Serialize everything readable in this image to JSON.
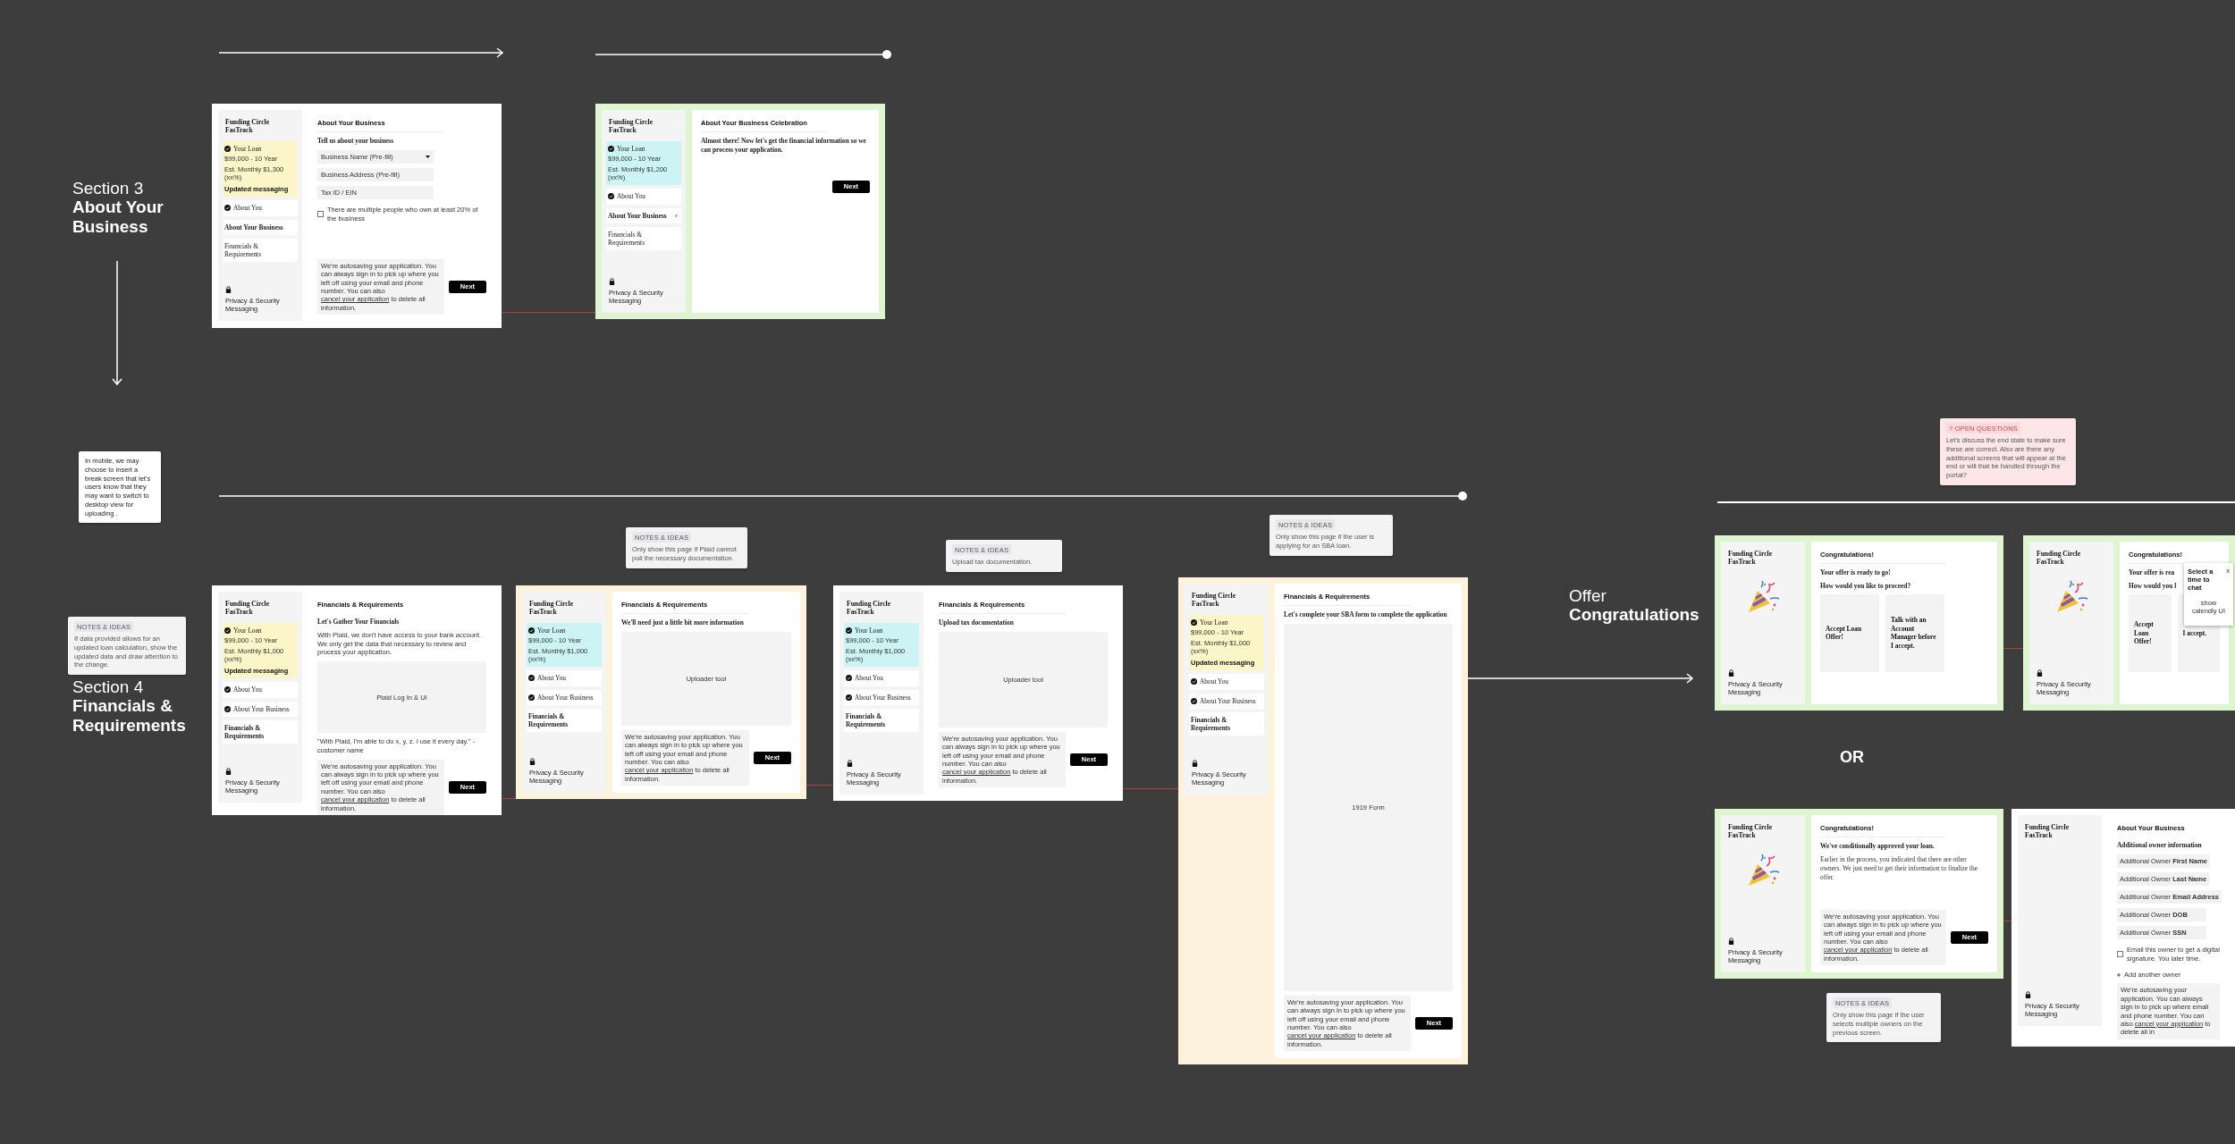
{
  "canvas": {
    "section_labels": [
      {
        "number": "Section 3",
        "title": "About Your Business"
      },
      {
        "number": "Section 4",
        "title": "Financials & Requirements"
      },
      {
        "number": "Offer",
        "title": "Congratulations"
      }
    ],
    "or_label": "OR",
    "notes": [
      {
        "kind": "plain",
        "text": "In mobile, we may choose to insert a break screen that let's users know that they may want to switch to desktop view for uploading ."
      },
      {
        "kind": "note",
        "tag": "NOTES & IDEAS",
        "text": "If data provided allows for an updated loan calculation, show the updated data and draw attention to the change."
      },
      {
        "kind": "note",
        "tag": "NOTES & IDEAS",
        "text": "Only show this page if Plaid cannot pull the necessary documentation."
      },
      {
        "kind": "note",
        "tag": "NOTES & IDEAS",
        "text": "Upload tax documentation."
      },
      {
        "kind": "note",
        "tag": "NOTES & IDEAS",
        "text": "Only show this page if the user is applying for an SBA loan."
      },
      {
        "kind": "question",
        "marker": "?",
        "tag": "OPEN QUESTIONS",
        "text": "Let's discuss the end state to make sure these are correct. Also are there any additional screens that will appear at the end or will that be handled through the portal?"
      },
      {
        "kind": "note",
        "tag": "NOTES & IDEAS",
        "text": "Only show this page if the user selects multiple owners on the previous screen."
      }
    ],
    "frames": [
      {
        "color": "#ffffff",
        "sidebar": {
          "kind": "steps",
          "brand": "Funding Circle FasTrack",
          "steps": [
            {
              "label": "Your Loan",
              "done": true,
              "current": false,
              "color": "#fbf5c8",
              "details": [
                "$99,000  - 10 Year",
                "Est. Monthly $1,300 (xx%)"
              ],
              "note": "Updated messaging"
            },
            {
              "label": "About You",
              "done": true,
              "current": false,
              "color": "#ffffff"
            },
            {
              "label": "About Your Business",
              "done": false,
              "current": true,
              "color": "#ffffff"
            },
            {
              "label": "Financials & Requirements",
              "done": false,
              "current": false,
              "color": "#ffffff"
            }
          ],
          "privacy": "Privacy & Security Messaging"
        },
        "main": {
          "breadcrumb": "About Your Business",
          "heading": "Tell us about your business",
          "blocks": [
            {
              "kind": "select",
              "placeholder": "Business Name (Pre-fill)"
            },
            {
              "kind": "field",
              "placeholder": "Business Address (Pre-fill)"
            },
            {
              "kind": "field",
              "placeholder": "Tax ID / EIN"
            },
            {
              "kind": "checkbox",
              "label": "There are multiple people who own at least 20% of the business",
              "checked": false
            }
          ],
          "autosave": {
            "before": "We're autosaving your application. You can always sign in to pick up where you left off using your email and phone number. You can also ",
            "link": "cancel your application",
            "after": " to delete all information."
          },
          "next": "Next"
        }
      },
      {
        "color": "#dff5cf",
        "sidebar": {
          "kind": "steps",
          "brand": "Funding Circle FasTrack",
          "steps": [
            {
              "label": "Your Loan",
              "done": true,
              "current": false,
              "celebrate": false,
              "color": "#cdf4f4",
              "details": [
                "$99,000  - 10 Year",
                "Est. Monthly $1,200 (xx%)"
              ]
            },
            {
              "label": "About You",
              "done": true,
              "current": false,
              "celebrate": false,
              "color": "#ffffff"
            },
            {
              "label": "About Your Business",
              "done": false,
              "current": true,
              "celebrate": true,
              "color": "#ffffff"
            },
            {
              "label": "Financials & Requirements",
              "done": false,
              "current": false,
              "celebrate": false,
              "color": "#ffffff"
            }
          ],
          "privacy": "Privacy & Security Messaging"
        },
        "main": {
          "breadcrumb": "About Your Business Celebration",
          "heading": "Almost there! Now let's get the financial information so we can process your application.",
          "blocks": [
            {
              "kind": "next",
              "label": "Next"
            }
          ]
        }
      },
      {
        "color": "#ffffff",
        "sidebar": {
          "kind": "steps",
          "brand": "Funding Circle FasTrack",
          "steps": [
            {
              "label": "Your Loan",
              "done": true,
              "current": false,
              "color": "#fbf5c8",
              "details": [
                "$99,000  - 10 Year",
                "Est. Monthly $1,000 (xx%)"
              ],
              "note": "Updated messaging"
            },
            {
              "label": "About You",
              "done": true,
              "current": false,
              "color": "#ffffff"
            },
            {
              "label": "About Your Business",
              "done": true,
              "current": false,
              "color": "#ffffff"
            },
            {
              "label": "Financials & Requirements",
              "done": false,
              "current": true,
              "color": "#ffffff"
            }
          ],
          "privacy": "Privacy & Security Messaging"
        },
        "main": {
          "breadcrumb": "Financials & Requirements",
          "heading": "Let's Gather Your Financials",
          "blocks": [
            {
              "kind": "sans_paragraph",
              "text": "With Plaid, we don't have access to your bank account. We only get the data that necessary to review and process your application."
            },
            {
              "kind": "placeholder",
              "label": "Plaid Log In & UI"
            },
            {
              "kind": "sans_paragraph",
              "text": "\"With Plaid, I'm able to do x, y, z. I use it every day.\" - customer name"
            }
          ],
          "autosave": {
            "before": "We're autosaving your application. You can always sign in to pick up where you left off using your email and phone number. You can also ",
            "link": "cancel your application",
            "after": " to delete all information."
          },
          "next": "Next"
        }
      },
      {
        "color": "#fdf3dd",
        "sidebar": {
          "kind": "steps",
          "brand": "Funding Circle FasTrack",
          "steps": [
            {
              "label": "Your Loan",
              "done": true,
              "current": false,
              "color": "#cdf4f4",
              "details": [
                "$99,000  - 10 Year",
                "Est. Monthly $1,000 (xx%)"
              ]
            },
            {
              "label": "About You",
              "done": true,
              "current": false,
              "color": "#ffffff"
            },
            {
              "label": "About Your Business",
              "done": true,
              "current": false,
              "color": "#ffffff"
            },
            {
              "label": "Financials & Requirements",
              "done": false,
              "current": true,
              "color": "#ffffff"
            }
          ],
          "privacy": "Privacy & Security Messaging"
        },
        "main": {
          "breadcrumb": "Financials & Requirements",
          "heading": "We'll need just a little bit more information",
          "blocks": [
            {
              "kind": "placeholder",
              "label": "Uploader tool"
            }
          ],
          "autosave": {
            "before": "We're autosaving your application. You can always sign in to pick up where you left off using your email and phone number. You can also ",
            "link": "cancel your application",
            "after": " to delete all information."
          },
          "next": "Next"
        }
      },
      {
        "color": "#ffffff",
        "sidebar": {
          "kind": "steps",
          "brand": "Funding Circle FasTrack",
          "steps": [
            {
              "label": "Your Loan",
              "done": true,
              "current": false,
              "color": "#cdf4f4",
              "details": [
                "$99,000  - 10 Year",
                "Est. Monthly $1,000 (xx%)"
              ]
            },
            {
              "label": "About You",
              "done": true,
              "current": false,
              "color": "#ffffff"
            },
            {
              "label": "About Your Business",
              "done": true,
              "current": false,
              "color": "#ffffff"
            },
            {
              "label": "Financials & Requirements",
              "done": false,
              "current": true,
              "color": "#ffffff"
            }
          ],
          "privacy": "Privacy & Security Messaging"
        },
        "main": {
          "breadcrumb": "Financials & Requirements",
          "heading": "Upload tax documentation",
          "blocks": [
            {
              "kind": "placeholder",
              "label": "Uploader tool"
            }
          ],
          "autosave": {
            "before": "We're autosaving your application. You can always sign in to pick up where you left off using your email and phone number. You can also ",
            "link": "cancel your application",
            "after": " to delete all information."
          },
          "next": "Next"
        }
      },
      {
        "color": "#fdf3dd",
        "sidebar": {
          "kind": "steps",
          "brand": "Funding Circle FasTrack",
          "steps": [
            {
              "label": "Your Loan",
              "done": true,
              "current": false,
              "color": "#fbf5c8",
              "details": [
                "$99,000  - 10 Year",
                "Est. Monthly $1,000 (xx%)"
              ],
              "note": "Updated messaging"
            },
            {
              "label": "About You",
              "done": true,
              "current": false,
              "color": "#ffffff"
            },
            {
              "label": "About Your Business",
              "done": true,
              "current": false,
              "color": "#ffffff"
            },
            {
              "label": "Financials & Requirements",
              "done": false,
              "current": true,
              "color": "#ffffff"
            }
          ],
          "privacy": "Privacy & Security Messaging"
        },
        "main": {
          "breadcrumb": "Financials & Requirements",
          "heading": "Let's complete your SBA form to complete the application",
          "blocks": [
            {
              "kind": "placeholder",
              "label": "1919 Form"
            }
          ],
          "autosave": {
            "before": "We're autosaving your application. You can always sign in to pick up where you left off using your email and phone number. You can also ",
            "link": "cancel your application",
            "after": " to delete all information."
          },
          "next": "Next"
        }
      },
      {
        "color": "#dff5cf",
        "sidebar": {
          "kind": "celebration",
          "brand": "Funding Circle FasTrack",
          "privacy": "Privacy & Security Messaging"
        },
        "main": {
          "breadcrumb": "Congratulations!",
          "heading": "Your offer is ready to go!",
          "blocks": [
            {
              "kind": "subheading",
              "text": "How would you like to proceed?"
            },
            {
              "kind": "choices",
              "options": [
                "Accept Loan Offer!",
                "Talk with an Account Manager before I accept."
              ]
            }
          ]
        }
      },
      {
        "color": "#dff5cf",
        "sidebar": {
          "kind": "celebration",
          "brand": "Funding Circle FasTrack",
          "privacy": "Privacy & Security Messaging"
        },
        "main": {
          "breadcrumb": "Congratulations!",
          "heading": "Your offer is rea",
          "blocks": [
            {
              "kind": "subheading",
              "text": "How would you l"
            },
            {
              "kind": "choices",
              "options": [
                "Accept Loan Offer!",
                "I accept."
              ]
            }
          ]
        },
        "modal": {
          "title": "Select a time to chat",
          "close": "x",
          "body": "show calendly UI"
        }
      },
      {
        "color": "#dff5cf",
        "sidebar": {
          "kind": "celebration",
          "brand": "Funding Circle FasTrack",
          "privacy": "Privacy & Security Messaging"
        },
        "main": {
          "breadcrumb": "Congratulations!",
          "heading": "We've conditionally approved your loan.",
          "blocks": [
            {
              "kind": "paragraph",
              "text": "Earlier in the process, you indicated that there are other owners. We just need to get their information to finalize the offer."
            }
          ],
          "autosave": {
            "before": "We're autosaving your application. You can always sign in to pick up where you left off using your email and phone number. You can also ",
            "link": "cancel your application",
            "after": " to delete all information."
          },
          "next": "Next"
        }
      },
      {
        "color": "#ffffff",
        "sidebar": {
          "kind": "plain",
          "brand": "Funding Circle FasTrack",
          "privacy": "Privacy & Security Messaging"
        },
        "main": {
          "breadcrumb": "About Your Business",
          "heading": "Additional owner information",
          "blocks": [
            {
              "kind": "owner_field",
              "label": "Additional Owner **First Name**"
            },
            {
              "kind": "owner_field",
              "label": "Additional Owner **Last Name**"
            },
            {
              "kind": "owner_field",
              "label": "Additional Owner **Email Address**"
            },
            {
              "kind": "owner_field",
              "label": "Additional Owner **DOB**"
            },
            {
              "kind": "owner_field",
              "label": "Additional Owner **SSN**"
            },
            {
              "kind": "checkbox",
              "label": "Email this owner to get a digital signature. You later time.",
              "checked": false
            },
            {
              "kind": "add",
              "label": "Add another owner"
            }
          ],
          "autosave": {
            "before": "We're autosaving your application. You can always sign in to pick up where email and phone number. You can also ",
            "link": "cancel your application",
            "after": " to delete all in"
          }
        }
      }
    ]
  }
}
